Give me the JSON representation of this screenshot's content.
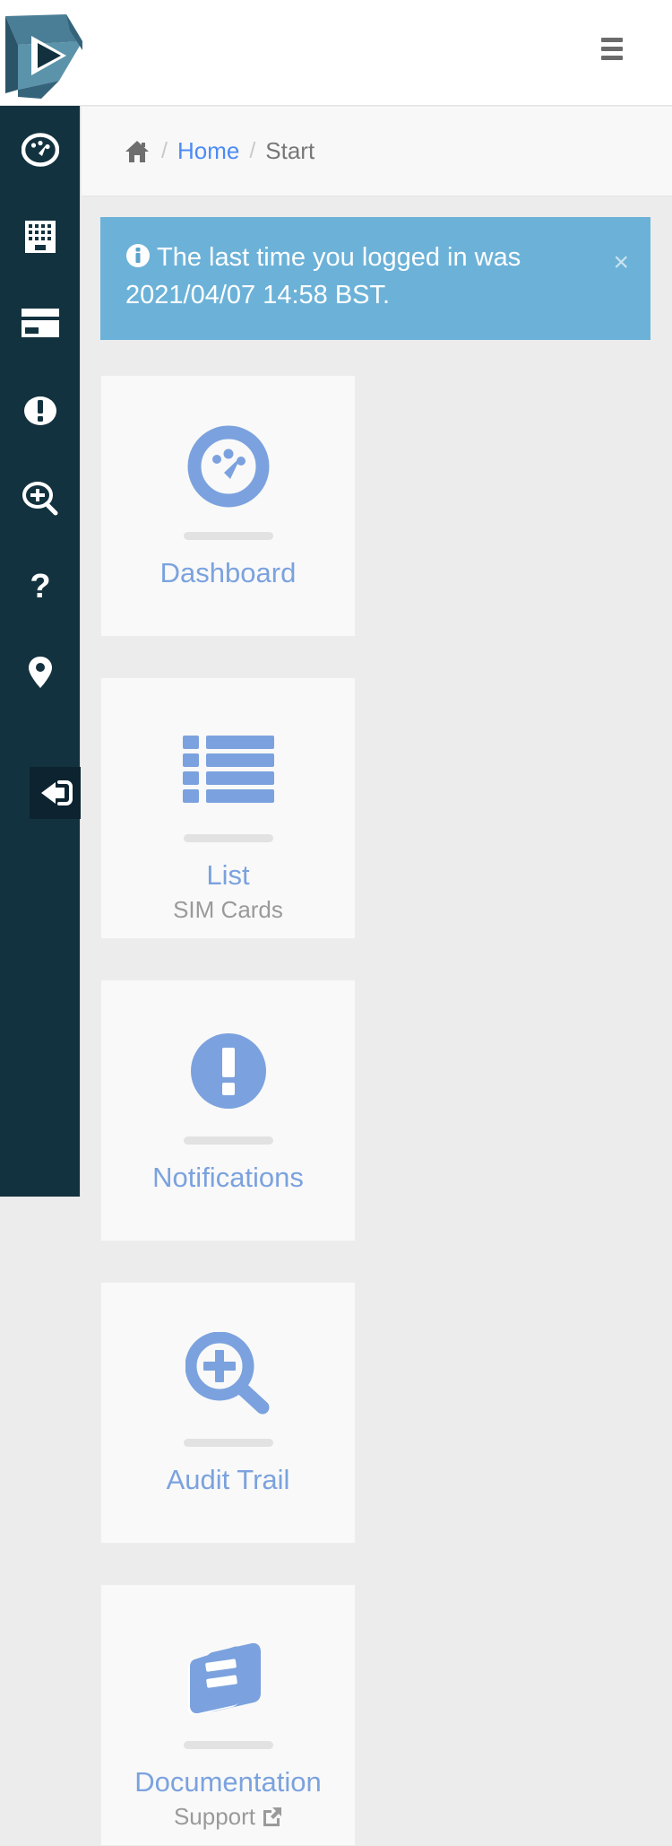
{
  "header": {
    "logo_name": "play-triangle-logo",
    "menu_label": "menu-toggle"
  },
  "breadcrumb": {
    "home_icon": "home-icon",
    "separator": "/",
    "items": [
      {
        "label": "Home",
        "link": true
      },
      {
        "label": "Start",
        "link": false
      }
    ]
  },
  "sidebar": {
    "items": [
      {
        "icon": "tachometer-icon",
        "name": "dashboard"
      },
      {
        "icon": "building-icon",
        "name": "organisation"
      },
      {
        "icon": "sim-card-icon",
        "name": "sim-cards"
      },
      {
        "icon": "exclamation-circle-icon",
        "name": "notifications"
      },
      {
        "icon": "search-plus-icon",
        "name": "audit-trail"
      },
      {
        "icon": "question-mark-icon",
        "name": "help"
      },
      {
        "icon": "map-pin-icon",
        "name": "location"
      },
      {
        "icon": "logout-icon",
        "name": "logout",
        "active": true
      }
    ]
  },
  "alert": {
    "icon": "info-circle-icon",
    "message": "The last time you logged in was 2021/04/07 14:58 BST.",
    "close_label": "×",
    "color": "#6cb2d8"
  },
  "cards": [
    {
      "title": "Dashboard",
      "subtitle": "",
      "icon": "tachometer-icon",
      "external": false
    },
    {
      "title": "List",
      "subtitle": "SIM Cards",
      "icon": "list-icon",
      "external": false
    },
    {
      "title": "Notifications",
      "subtitle": "",
      "icon": "exclamation-circle-icon",
      "external": false
    },
    {
      "title": "Audit Trail",
      "subtitle": "",
      "icon": "search-plus-icon",
      "external": false
    },
    {
      "title": "Documentation",
      "subtitle": "Support",
      "icon": "book-icon",
      "external": true
    }
  ],
  "colors": {
    "sidebar_bg": "#13323f",
    "accent_blue": "#7ba2de",
    "link_blue": "#4c8bf5",
    "alert_blue": "#6cb2d8",
    "page_bg": "#ececec",
    "card_bg": "#f9f9f9"
  }
}
